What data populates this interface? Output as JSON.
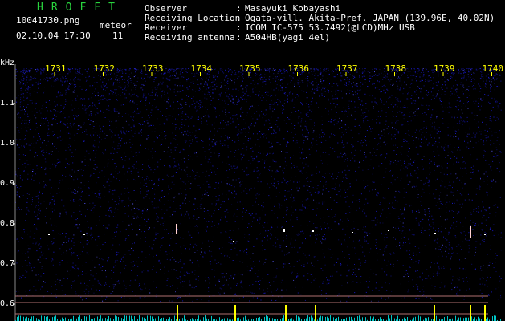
{
  "header": {
    "brand": "HROFFT",
    "filename": "10041730.png",
    "datetime": "02.10.04 17:30",
    "meteor_label": "meteor",
    "meteor_count": "11",
    "info": [
      {
        "label": "Observer",
        "value": "Masayuki Kobayashi"
      },
      {
        "label": "Receiving Location",
        "value": "Ogata-vill. Akita-Pref. JAPAN (139.96E, 40.02N)"
      },
      {
        "label": "Receiver",
        "value": "ICOM IC-575 53.7492(@LCD)MHz USB"
      },
      {
        "label": "Receiving antenna",
        "value": "A504HB(yagi 4el)"
      }
    ]
  },
  "plot": {
    "y_unit": "kHz",
    "y_ticks": [
      "1.1",
      "1.0",
      "0.9",
      "0.8",
      "0.7",
      "0.6"
    ],
    "x_ticks": [
      "1731",
      "1732",
      "1733",
      "1734",
      "1735",
      "1736",
      "1737",
      "1738",
      "1739",
      "1740"
    ],
    "colors": {
      "background": "#000000",
      "noise": "#1a1ad0",
      "meteor_echo": "#ffffff",
      "tick_label": "#ffff00",
      "level_trace": "#00c8c8",
      "level_peak": "#ffff00",
      "ref_line": "#b07070"
    }
  }
}
